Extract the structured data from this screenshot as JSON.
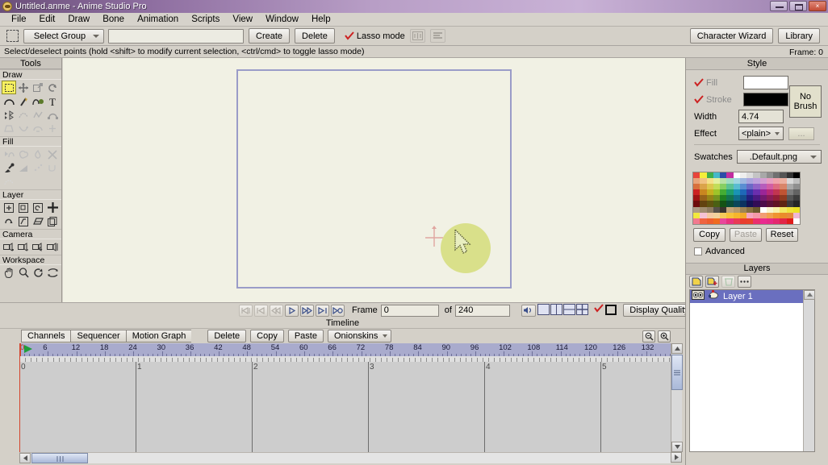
{
  "window": {
    "title": "Untitled.anme - Anime Studio Pro",
    "app_icon": "anime-studio-icon",
    "minimize": "minimize-icon",
    "maximize": "maximize-icon",
    "close": "×"
  },
  "menubar": {
    "items": [
      "File",
      "Edit",
      "Draw",
      "Bone",
      "Animation",
      "Scripts",
      "View",
      "Window",
      "Help"
    ]
  },
  "toolbar": {
    "select_group_label": "Select Group",
    "group_name_value": "",
    "group_name_placeholder": "",
    "create_label": "Create",
    "delete_label": "Delete",
    "lasso_label": "Lasso mode",
    "lasso_checked": true,
    "character_wizard_label": "Character Wizard",
    "library_label": "Library"
  },
  "hintbar": {
    "text": "Select/deselect points (hold <shift> to modify current selection, <ctrl/cmd> to toggle lasso mode)",
    "frame_indicator": "Frame: 0"
  },
  "tools": {
    "panel_title": "Tools",
    "groups": [
      {
        "label": "Draw",
        "tools": [
          {
            "name": "select-points-tool",
            "selected": true
          },
          {
            "name": "transform-points-tool",
            "selected": false
          },
          {
            "name": "scale-points-tool",
            "selected": false
          },
          {
            "name": "rotate-points-tool",
            "selected": false
          },
          {
            "name": "curvature-tool",
            "selected": false
          },
          {
            "name": "add-point-tool",
            "selected": false
          },
          {
            "name": "draw-shape-tool",
            "selected": false
          },
          {
            "name": "text-tool",
            "selected": false
          },
          {
            "name": "magnet-tool",
            "selected": false
          },
          {
            "name": "bind-points-tool",
            "selected": false
          },
          {
            "name": "noise-tool",
            "selected": false
          },
          {
            "name": "shear-points-tool",
            "selected": false
          },
          {
            "name": "perspective-points-tool",
            "selected": false
          },
          {
            "name": "bend-points-tool",
            "selected": false
          },
          {
            "name": "hide-edge-tool",
            "selected": false
          },
          {
            "name": "weld-points-tool",
            "selected": false
          }
        ]
      },
      {
        "label": "Fill",
        "tools": [
          {
            "name": "select-shape-tool",
            "selected": false
          },
          {
            "name": "create-shape-tool",
            "selected": false
          },
          {
            "name": "paint-bucket-tool",
            "selected": false
          },
          {
            "name": "delete-shape-tool",
            "selected": false
          },
          {
            "name": "eyedropper-tool",
            "selected": false
          },
          {
            "name": "gradient-tool",
            "selected": false
          },
          {
            "name": "scatter-brush-tool",
            "selected": false
          },
          {
            "name": "curve-profile-tool",
            "selected": false
          },
          {
            "name": "stroke-exposure-tool",
            "selected": false
          }
        ]
      },
      {
        "label": "Layer",
        "tools": [
          {
            "name": "translate-layer-tool",
            "selected": false
          },
          {
            "name": "scale-layer-tool",
            "selected": false
          },
          {
            "name": "rotate-layer-z-tool",
            "selected": false
          },
          {
            "name": "add-layer-tool",
            "selected": false
          },
          {
            "name": "rotate-layer-x-tool",
            "selected": false
          },
          {
            "name": "shear-layer-tool",
            "selected": false
          },
          {
            "name": "flip-layer-tool",
            "selected": false
          },
          {
            "name": "set-origin-tool",
            "selected": false
          }
        ]
      },
      {
        "label": "Camera",
        "tools": [
          {
            "name": "track-camera-tool",
            "selected": false
          },
          {
            "name": "zoom-camera-tool",
            "selected": false
          },
          {
            "name": "roll-camera-tool",
            "selected": false
          },
          {
            "name": "pan-tilt-camera-tool",
            "selected": false
          }
        ]
      },
      {
        "label": "Workspace",
        "tools": [
          {
            "name": "pan-workspace-tool",
            "selected": false
          },
          {
            "name": "zoom-workspace-tool",
            "selected": false
          },
          {
            "name": "rotate-workspace-tool",
            "selected": false
          },
          {
            "name": "orbit-workspace-tool",
            "selected": false
          }
        ]
      }
    ]
  },
  "canvas": {
    "background_color": "#f1f1e4",
    "document_border_color": "#9a9cc8",
    "origin_marker": "origin-crosshair",
    "selection_blob_color": "#d9e08a",
    "cursor": "arrow-cursor"
  },
  "playback": {
    "buttons": [
      {
        "name": "rewind-to-start-button",
        "glyph": "|◁|",
        "disabled": true
      },
      {
        "name": "previous-keyframe-button",
        "glyph": "|◁",
        "disabled": true
      },
      {
        "name": "step-back-button",
        "glyph": "◁◁",
        "disabled": true
      },
      {
        "name": "play-button",
        "glyph": "▷",
        "disabled": false
      },
      {
        "name": "fast-forward-button",
        "glyph": "▷▷",
        "disabled": false
      },
      {
        "name": "next-keyframe-button",
        "glyph": "▷|",
        "disabled": false
      },
      {
        "name": "go-to-end-button",
        "glyph": "▷○",
        "disabled": false
      }
    ],
    "frame_label": "Frame",
    "frame_value": "0",
    "of_label": "of",
    "total_frames_value": "240",
    "audio_icon": "speaker-icon",
    "view_buttons": [
      "single-view",
      "dual-view",
      "triple-view",
      "quad-view"
    ],
    "onion_check": true,
    "bounds_icon": "bounds-icon",
    "display_quality_label": "Display Quality"
  },
  "timeline": {
    "title": "Timeline",
    "tabs": [
      {
        "label": "Channels",
        "active": true
      },
      {
        "label": "Sequencer",
        "active": false
      },
      {
        "label": "Motion Graph",
        "active": false
      }
    ],
    "buttons": [
      "Delete",
      "Copy",
      "Paste"
    ],
    "onionskins_label": "Onionskins",
    "zoom_out_icon": "zoom-out-icon",
    "zoom_in_icon": "zoom-in-icon",
    "ruler_labels": [
      "0",
      "6",
      "12",
      "18",
      "24",
      "30",
      "36",
      "42",
      "48",
      "54",
      "60",
      "66",
      "72",
      "78",
      "84",
      "90",
      "96",
      "102",
      "108",
      "114",
      "120",
      "126",
      "132"
    ],
    "grid_labels": [
      "0",
      "1",
      "2",
      "3",
      "4",
      "5"
    ],
    "playhead_frame": 0
  },
  "style": {
    "title": "Style",
    "fill_label": "Fill",
    "fill_checked": true,
    "fill_color": "#ffffff",
    "stroke_label": "Stroke",
    "stroke_checked": true,
    "stroke_color": "#000000",
    "width_label": "Width",
    "width_value": "4.74",
    "effect_label": "Effect",
    "effect_value": "<plain>",
    "effect_more_label": "...",
    "no_brush_line1": "No",
    "no_brush_line2": "Brush",
    "swatches_label": "Swatches",
    "swatches_value": ".Default.png",
    "copy_label": "Copy",
    "paste_label": "Paste",
    "paste_disabled": true,
    "reset_label": "Reset",
    "advanced_label": "Advanced",
    "advanced_checked": false,
    "palette_colors": [
      "#e8443c",
      "#f5ee3a",
      "#3fae4b",
      "#46b8c9",
      "#2b4ea8",
      "#c22fa0",
      "#ffffff",
      "#eeeeee",
      "#dddddd",
      "#c4c4c4",
      "#a8a8a8",
      "#8d8d8d",
      "#707070",
      "#555555",
      "#323232",
      "#000000",
      "#e8a47a",
      "#f0c182",
      "#f5e089",
      "#e4f0a0",
      "#b9e2a6",
      "#9fdcc2",
      "#9fd6e0",
      "#9fb8e0",
      "#a9a3dc",
      "#bda0dc",
      "#d49fd0",
      "#e79fc0",
      "#f0a3ab",
      "#ecb0a0",
      "#d9d9d9",
      "#bfbfbf",
      "#d9703c",
      "#dba34a",
      "#ddc74e",
      "#c3dd58",
      "#86cf63",
      "#5bc294",
      "#58bcd0",
      "#5a8ed2",
      "#6a69c6",
      "#9164c8",
      "#b65dbc",
      "#d25da4",
      "#de6c80",
      "#d98569",
      "#a9a9a9",
      "#8f8f8f",
      "#cc2222",
      "#c98620",
      "#c7b021",
      "#9fc42a",
      "#44ad34",
      "#1f9e6d",
      "#1a94b4",
      "#1f68b8",
      "#3a36a8",
      "#6a2fae",
      "#9b2697",
      "#b72a78",
      "#c23550",
      "#c05433",
      "#7d7d7d",
      "#636363",
      "#9e1414",
      "#96621a",
      "#958318",
      "#759420",
      "#1f8020",
      "#147450",
      "#106e88",
      "#154d8c",
      "#23207e",
      "#4c1a82",
      "#741a6f",
      "#8a1d56",
      "#931f37",
      "#8f3b1f",
      "#555555",
      "#3d3d3d",
      "#6e0c0c",
      "#62420f",
      "#5f5410",
      "#4a6013",
      "#145214",
      "#0a4c36",
      "#09475a",
      "#0b3260",
      "#151254",
      "#320c56",
      "#4c0c49",
      "#5b1039",
      "#601224",
      "#5f2512",
      "#3a3a3a",
      "#262626",
      "#ad9c86",
      "#a08d70",
      "#8d7b62",
      "#57514a",
      "#3a342e",
      "#c4a579",
      "#b79a6a",
      "#9e8455",
      "#87703f",
      "#6b5a2e",
      "#ffffff",
      "#f8f4cd",
      "#f7f0a8",
      "#f2e864",
      "#f0e33c",
      "#ece226",
      "#f2e93e",
      "#f6c3d4",
      "#f5cba4",
      "#f3d29c",
      "#f6ca5c",
      "#f7c23a",
      "#f6b62c",
      "#f3a92a",
      "#f5a5c0",
      "#f49aa8",
      "#f29d74",
      "#f0a04e",
      "#ef9330",
      "#ea8c2a",
      "#e68a3c",
      "#efb8d6",
      "#f2798f",
      "#ef6440",
      "#ee5e2e",
      "#ef6b1f",
      "#e8479b",
      "#e8337e",
      "#e93b55",
      "#e93d2f",
      "#e9412a",
      "#ea2e6e",
      "#e92b8f",
      "#e62a86",
      "#e5286f",
      "#e12547",
      "#e01b1b",
      "#ffffff"
    ]
  },
  "layers": {
    "title": "Layers",
    "toolbar_buttons": [
      {
        "name": "new-layer-button",
        "disabled": false
      },
      {
        "name": "duplicate-layer-button",
        "disabled": false
      },
      {
        "name": "delete-layer-button",
        "disabled": true
      },
      {
        "name": "layer-options-button",
        "disabled": false
      }
    ],
    "rows": [
      {
        "name": "Layer 1",
        "visible_icon": "eyes-icon",
        "type_icon": "vector-layer-icon",
        "selected": true
      }
    ]
  }
}
